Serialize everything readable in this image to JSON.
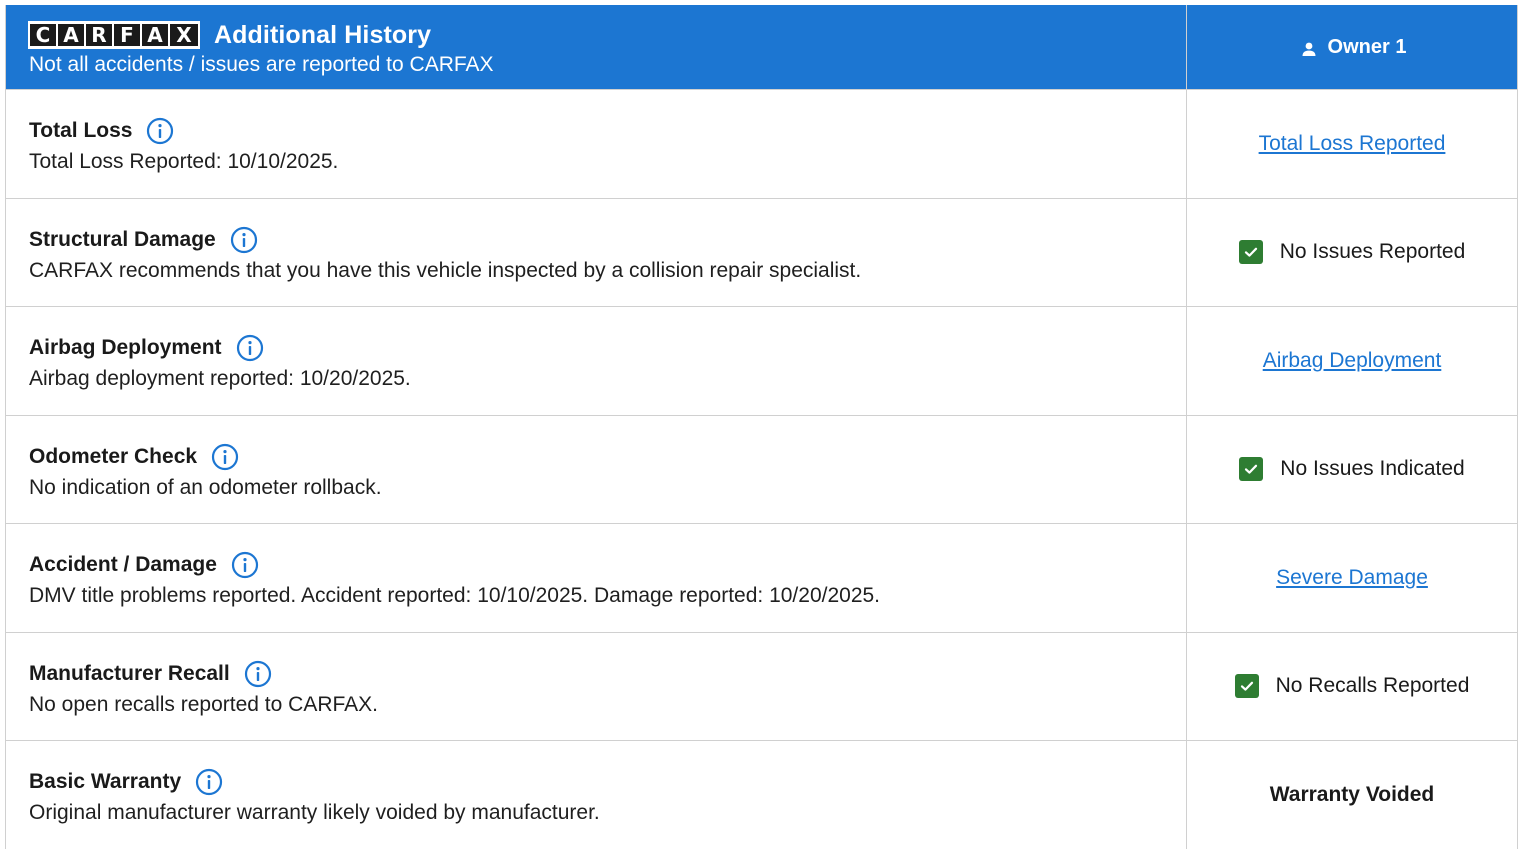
{
  "header": {
    "logo_letters": [
      "C",
      "A",
      "R",
      "F",
      "A",
      "X"
    ],
    "title": "Additional History",
    "subtitle": "Not all accidents / issues are reported to CARFAX",
    "owner_label": "Owner 1"
  },
  "colors": {
    "header_bg": "#1c76d2",
    "link": "#1c76d2",
    "check_green": "#2e7d32"
  },
  "rows": [
    {
      "title": "Total Loss",
      "description": "Total Loss Reported: 10/10/2025.",
      "status": "Total Loss Reported",
      "status_type": "link"
    },
    {
      "title": "Structural Damage",
      "description": "CARFAX recommends that you have this vehicle inspected by a collision repair specialist.",
      "status": "No Issues Reported",
      "status_type": "check"
    },
    {
      "title": "Airbag Deployment",
      "description": "Airbag deployment reported: 10/20/2025.",
      "status": "Airbag Deployment",
      "status_type": "link"
    },
    {
      "title": "Odometer Check",
      "description": "No indication of an odometer rollback.",
      "status": "No Issues Indicated",
      "status_type": "check"
    },
    {
      "title": "Accident / Damage",
      "description": "DMV title problems reported. Accident reported: 10/10/2025. Damage reported: 10/20/2025.",
      "status": "Severe Damage",
      "status_type": "link"
    },
    {
      "title": "Manufacturer Recall",
      "description": "No open recalls reported to CARFAX.",
      "status": "No Recalls Reported",
      "status_type": "check"
    },
    {
      "title": "Basic Warranty",
      "description": "Original manufacturer warranty likely voided by manufacturer.",
      "status": "Warranty Voided",
      "status_type": "bold"
    }
  ]
}
